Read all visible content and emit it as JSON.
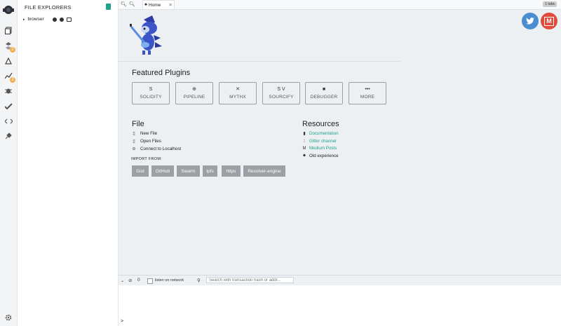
{
  "iconbar": {
    "icons": [
      {
        "name": "remix-logo-icon"
      },
      {
        "name": "file-explorers-icon"
      },
      {
        "name": "solidity-compiler-icon",
        "badge": "2"
      },
      {
        "name": "deploy-run-icon"
      },
      {
        "name": "analysis-icon",
        "badge": "2"
      },
      {
        "name": "debugger-icon"
      },
      {
        "name": "unit-testing-icon"
      },
      {
        "name": "plugin-icon"
      },
      {
        "name": "plugin-manager-icon"
      },
      {
        "name": "settings-icon"
      }
    ]
  },
  "sidepanel": {
    "title": "FILE EXPLORERS",
    "workspace": "browser"
  },
  "tabbar": {
    "home_tab": "Home",
    "tabs_count": "1 tabs"
  },
  "home": {
    "featured_title": "Featured Plugins",
    "plugins": [
      {
        "label": "SOLIDITY",
        "icon": "S"
      },
      {
        "label": "PIPELINE",
        "icon": "⊕"
      },
      {
        "label": "MYTHX",
        "icon": "✕"
      },
      {
        "label": "SOURCIFY",
        "icon": "S V"
      },
      {
        "label": "DEBUGGER",
        "icon": "■"
      },
      {
        "label": "MORE",
        "icon": "•••"
      }
    ],
    "file_title": "File",
    "file_items": [
      {
        "label": "New File",
        "icon": "📄"
      },
      {
        "label": "Open Files",
        "icon": "📄"
      },
      {
        "label": "Connect to Localhost",
        "icon": "⛁"
      }
    ],
    "import_title": "IMPORT FROM:",
    "import_buttons": [
      "Gist",
      "GitHub",
      "Swarm",
      "Ipfs",
      "https",
      "Resolver-engine"
    ],
    "resources_title": "Resources",
    "resources": [
      {
        "label": "Documentation",
        "link": true
      },
      {
        "label": "Gitter channel",
        "link": true
      },
      {
        "label": "Medium Posts",
        "link": true
      },
      {
        "label": "Old experience",
        "link": false
      }
    ]
  },
  "terminal": {
    "count": "0",
    "listen_label": "listen on network",
    "search_placeholder": "Search with transaction hash or addr...",
    "prompt": ">"
  },
  "colors": {
    "accent": "#1fa28b",
    "twitter": "#4a8ed1",
    "medium": "#e04b3c",
    "badge": "#f0ad4e"
  }
}
